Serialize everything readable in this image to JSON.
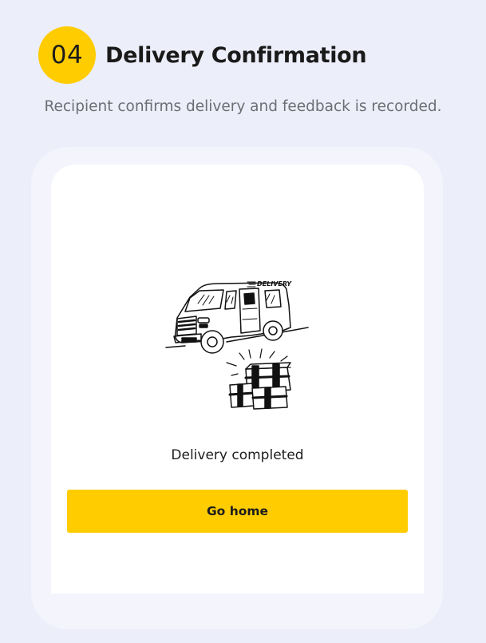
{
  "step": {
    "number": "04",
    "title": "Delivery Confirmation",
    "subtitle": "Recipient confirms delivery and feedback is recorded."
  },
  "screen": {
    "illustration": {
      "van_text": "DELIVERY",
      "icon": "delivery-van-with-packages-illustration"
    },
    "status_text": "Delivery completed",
    "button_label": "Go home"
  },
  "colors": {
    "background": "#ECEEF9",
    "frame": "#F3F4FC",
    "screen": "#FFFFFF",
    "accent": "#FFCC00",
    "title_text": "#1A1A1A",
    "subtitle_text": "#6D6E74"
  }
}
